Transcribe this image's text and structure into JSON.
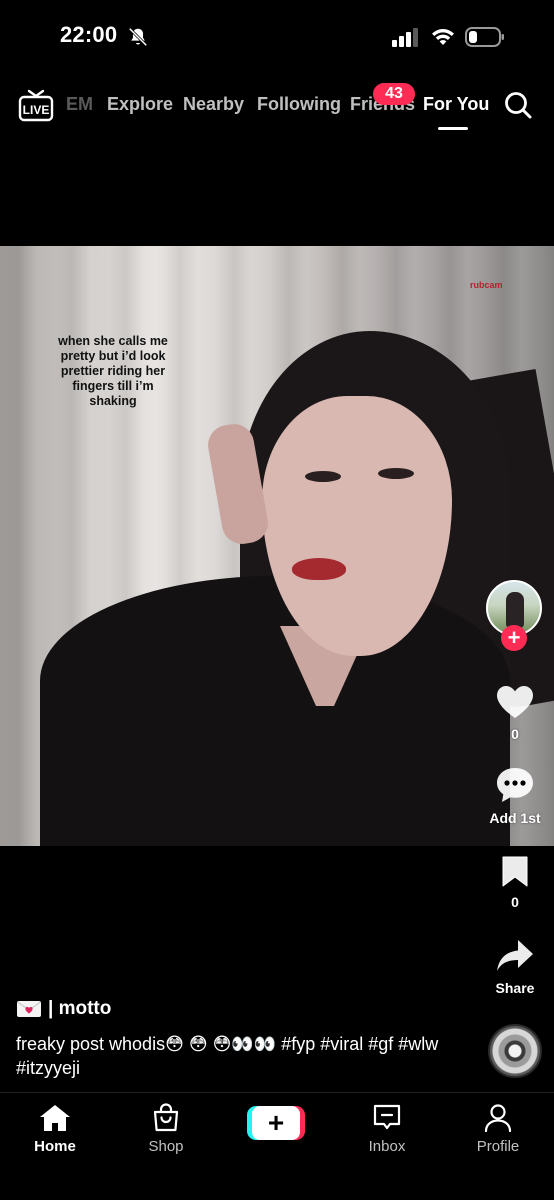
{
  "status_bar": {
    "time": "22:00",
    "icons": [
      "bell-slash-icon",
      "cellular-signal-icon",
      "wifi-icon",
      "battery-icon"
    ]
  },
  "top_nav": {
    "live_label": "LIVE",
    "tabs": [
      {
        "label": "EM",
        "state": "faded"
      },
      {
        "label": "Explore"
      },
      {
        "label": "Nearby"
      },
      {
        "label": "Following"
      },
      {
        "label": "Friends",
        "badge": "43"
      },
      {
        "label": "For You",
        "state": "active"
      }
    ],
    "badge_color": "#fe2c55"
  },
  "video": {
    "overlay_caption": "when she calls me pretty but i’d look prettier riding her fingers till i’m shaking",
    "watermark": "rubcam"
  },
  "actions": {
    "likes": "0",
    "comments": "Add 1st",
    "saves": "0",
    "share": "Share"
  },
  "post": {
    "author": "| motto",
    "description": "freaky post whodis😳 😳 😳👀👀 #fyp #viral #gf #wlw #itzyyeji"
  },
  "bottom_nav": {
    "items": [
      {
        "label": "Home",
        "icon": "home-icon",
        "active": true
      },
      {
        "label": "Shop",
        "icon": "shopping-bag-icon"
      },
      {
        "label": "",
        "icon": "create-plus-icon"
      },
      {
        "label": "Inbox",
        "icon": "inbox-icon"
      },
      {
        "label": "Profile",
        "icon": "profile-icon"
      }
    ]
  },
  "colors": {
    "accent": "#fe2c55",
    "cyan": "#25f4ee",
    "background": "#000000"
  }
}
